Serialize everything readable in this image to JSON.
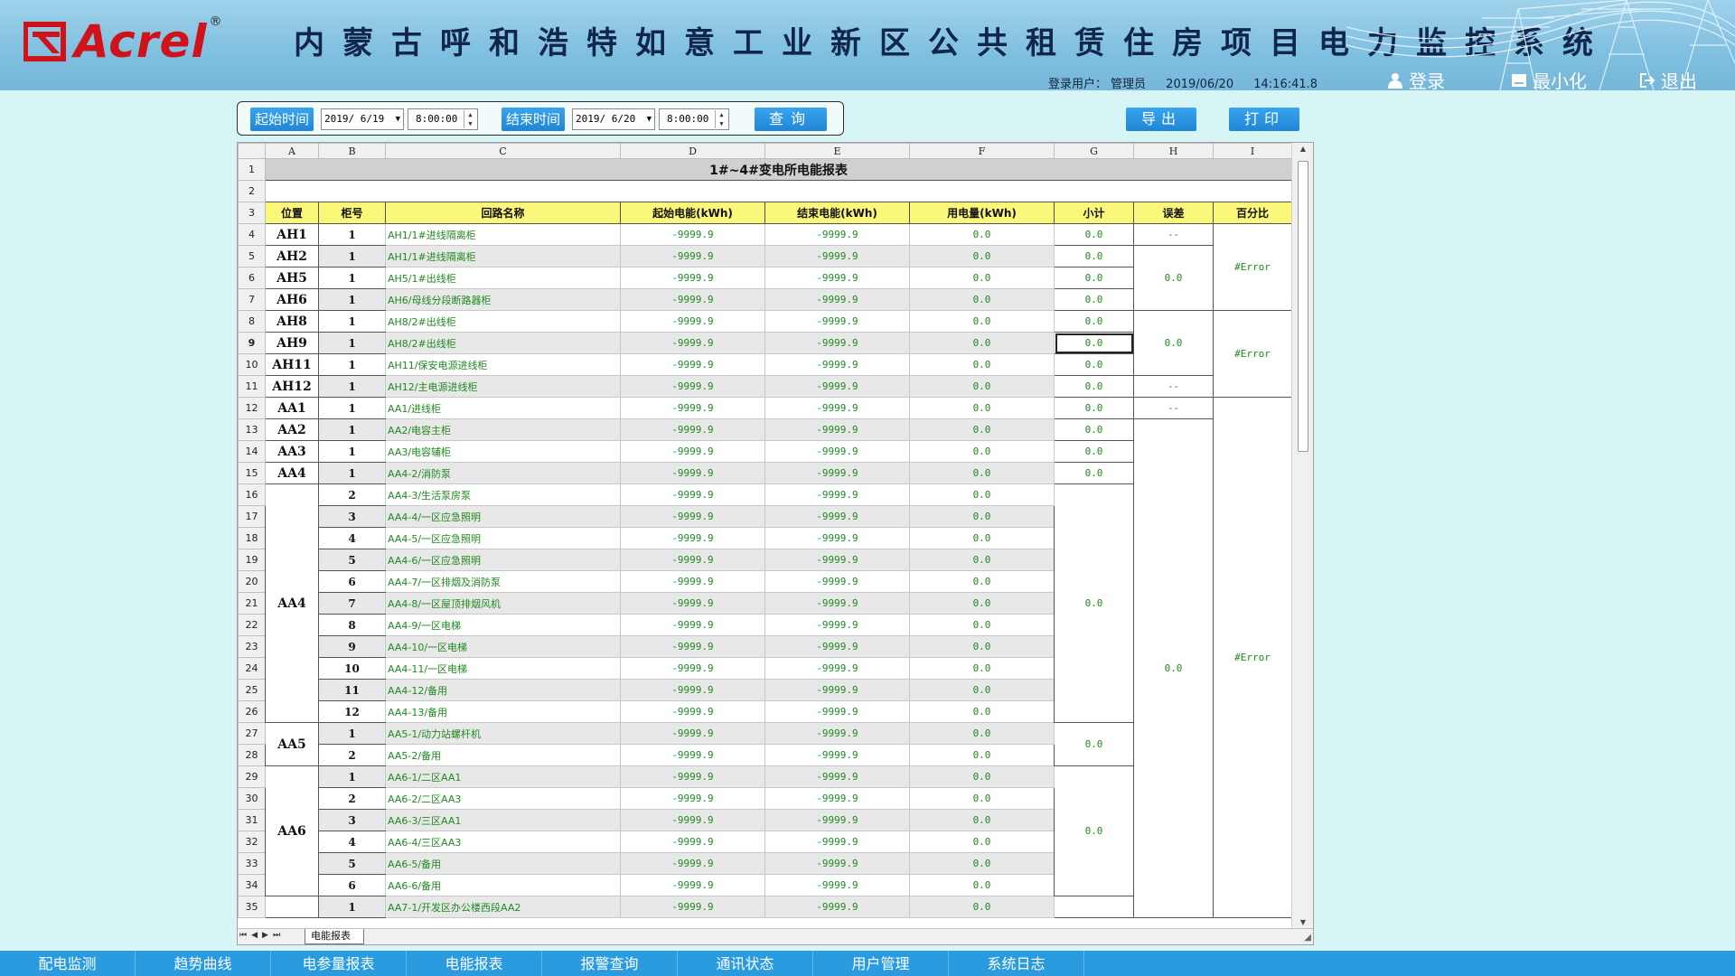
{
  "header": {
    "logo": "Acrel",
    "logo_reg": "®",
    "title": "内蒙古呼和浩特如意工业新区公共租赁住房项目电力监控系统",
    "login_label": "登录用户：",
    "user": "管理员",
    "date": "2019/06/20",
    "time": "14:16:41.8",
    "btn_login": "登录",
    "btn_minimize": "最小化",
    "btn_exit": "退出"
  },
  "toolbar": {
    "start_label": "起始时间",
    "start_date": "2019/ 6/19",
    "start_time": "8:00:00",
    "end_label": "结束时间",
    "end_date": "2019/ 6/20",
    "end_time": "8:00:00",
    "query": "查询",
    "export": "导出",
    "print": "打印"
  },
  "sheet": {
    "columns": [
      "A",
      "B",
      "C",
      "D",
      "E",
      "F",
      "G",
      "H",
      "I"
    ],
    "title": "1#~4#变电所电能报表",
    "headers": [
      "位置",
      "柜号",
      "回路名称",
      "起始电能(kWh)",
      "结束电能(kWh)",
      "用电量(kWh)",
      "小计",
      "误差",
      "百分比"
    ],
    "rows": [
      {
        "pos": "AH1",
        "cab": "1",
        "name": "AH1/1#进线隔离柜",
        "start": "-9999.9",
        "end": "-9999.9",
        "use": "0.0"
      },
      {
        "pos": "AH2",
        "cab": "1",
        "name": "AH1/1#进线隔离柜",
        "start": "-9999.9",
        "end": "-9999.9",
        "use": "0.0"
      },
      {
        "pos": "AH5",
        "cab": "1",
        "name": "AH5/1#出线柜",
        "start": "-9999.9",
        "end": "-9999.9",
        "use": "0.0"
      },
      {
        "pos": "AH6",
        "cab": "1",
        "name": "AH6/母线分段断路器柜",
        "start": "-9999.9",
        "end": "-9999.9",
        "use": "0.0"
      },
      {
        "pos": "AH8",
        "cab": "1",
        "name": "AH8/2#出线柜",
        "start": "-9999.9",
        "end": "-9999.9",
        "use": "0.0"
      },
      {
        "pos": "AH9",
        "cab": "1",
        "name": "AH8/2#出线柜",
        "start": "-9999.9",
        "end": "-9999.9",
        "use": "0.0"
      },
      {
        "pos": "AH11",
        "cab": "1",
        "name": "AH11/保安电源进线柜",
        "start": "-9999.9",
        "end": "-9999.9",
        "use": "0.0"
      },
      {
        "pos": "AH12",
        "cab": "1",
        "name": "AH12/主电源进线柜",
        "start": "-9999.9",
        "end": "-9999.9",
        "use": "0.0"
      },
      {
        "pos": "AA1",
        "cab": "1",
        "name": "AA1/进线柜",
        "start": "-9999.9",
        "end": "-9999.9",
        "use": "0.0"
      },
      {
        "pos": "AA2",
        "cab": "1",
        "name": "AA2/电容主柜",
        "start": "-9999.9",
        "end": "-9999.9",
        "use": "0.0"
      },
      {
        "pos": "AA3",
        "cab": "1",
        "name": "AA3/电容辅柜",
        "start": "-9999.9",
        "end": "-9999.9",
        "use": "0.0"
      },
      {
        "pos": "AA4",
        "cab": "1",
        "name": "AA4-2/消防泵",
        "start": "-9999.9",
        "end": "-9999.9",
        "use": "0.0"
      },
      {
        "pos": "AA4",
        "cab": "2",
        "name": "AA4-3/生活泵房泵",
        "start": "-9999.9",
        "end": "-9999.9",
        "use": "0.0"
      },
      {
        "pos": "AA4",
        "cab": "3",
        "name": "AA4-4/一区应急照明",
        "start": "-9999.9",
        "end": "-9999.9",
        "use": "0.0"
      },
      {
        "pos": "AA4",
        "cab": "4",
        "name": "AA4-5/一区应急照明",
        "start": "-9999.9",
        "end": "-9999.9",
        "use": "0.0"
      },
      {
        "pos": "AA4",
        "cab": "5",
        "name": "AA4-6/一区应急照明",
        "start": "-9999.9",
        "end": "-9999.9",
        "use": "0.0"
      },
      {
        "pos": "AA4",
        "cab": "6",
        "name": "AA4-7/一区排烟及消防泵",
        "start": "-9999.9",
        "end": "-9999.9",
        "use": "0.0"
      },
      {
        "pos": "AA4",
        "cab": "7",
        "name": "AA4-8/一区屋顶排烟风机",
        "start": "-9999.9",
        "end": "-9999.9",
        "use": "0.0"
      },
      {
        "pos": "AA4",
        "cab": "8",
        "name": "AA4-9/一区电梯",
        "start": "-9999.9",
        "end": "-9999.9",
        "use": "0.0"
      },
      {
        "pos": "AA4",
        "cab": "9",
        "name": "AA4-10/一区电梯",
        "start": "-9999.9",
        "end": "-9999.9",
        "use": "0.0"
      },
      {
        "pos": "AA4",
        "cab": "10",
        "name": "AA4-11/一区电梯",
        "start": "-9999.9",
        "end": "-9999.9",
        "use": "0.0"
      },
      {
        "pos": "AA4",
        "cab": "11",
        "name": "AA4-12/备用",
        "start": "-9999.9",
        "end": "-9999.9",
        "use": "0.0"
      },
      {
        "pos": "AA4",
        "cab": "12",
        "name": "AA4-13/备用",
        "start": "-9999.9",
        "end": "-9999.9",
        "use": "0.0"
      },
      {
        "pos": "AA5",
        "cab": "1",
        "name": "AA5-1/动力站螺杆机",
        "start": "-9999.9",
        "end": "-9999.9",
        "use": "0.0"
      },
      {
        "pos": "AA5",
        "cab": "2",
        "name": "AA5-2/备用",
        "start": "-9999.9",
        "end": "-9999.9",
        "use": "0.0"
      },
      {
        "pos": "AA6",
        "cab": "1",
        "name": "AA6-1/二区AA1",
        "start": "-9999.9",
        "end": "-9999.9",
        "use": "0.0"
      },
      {
        "pos": "AA6",
        "cab": "2",
        "name": "AA6-2/二区AA3",
        "start": "-9999.9",
        "end": "-9999.9",
        "use": "0.0"
      },
      {
        "pos": "AA6",
        "cab": "3",
        "name": "AA6-3/三区AA1",
        "start": "-9999.9",
        "end": "-9999.9",
        "use": "0.0"
      },
      {
        "pos": "AA6",
        "cab": "4",
        "name": "AA6-4/三区AA3",
        "start": "-9999.9",
        "end": "-9999.9",
        "use": "0.0"
      },
      {
        "pos": "AA6",
        "cab": "5",
        "name": "AA6-5/备用",
        "start": "-9999.9",
        "end": "-9999.9",
        "use": "0.0"
      },
      {
        "pos": "AA6",
        "cab": "6",
        "name": "AA6-6/备用",
        "start": "-9999.9",
        "end": "-9999.9",
        "use": "0.0"
      },
      {
        "pos": "",
        "cab": "1",
        "name": "AA7-1/开发区办公楼西段AA2",
        "start": "-9999.9",
        "end": "-9999.9",
        "use": "0.0"
      }
    ],
    "subtotal": "0.0",
    "dash": "--",
    "error": "#Error",
    "sheet_tab": "电能报表"
  },
  "nav": [
    "配电监测",
    "趋势曲线",
    "电参量报表",
    "电能报表",
    "报警查询",
    "通讯状态",
    "用户管理",
    "系统日志"
  ]
}
